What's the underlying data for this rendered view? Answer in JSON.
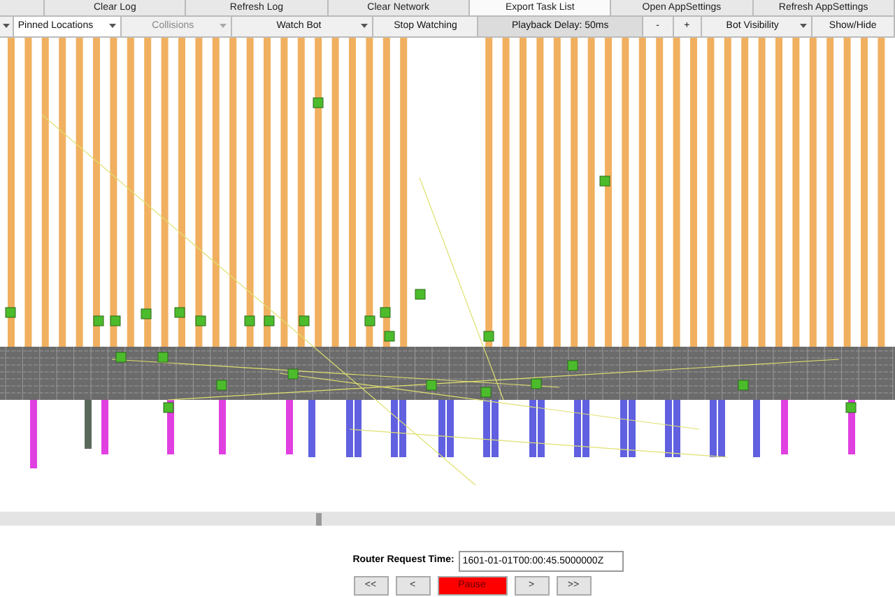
{
  "toolbar_row_1": [
    {
      "label": "Clear Log",
      "highlighted": false
    },
    {
      "label": "Refresh Log",
      "highlighted": false
    },
    {
      "label": "Clear Network",
      "highlighted": false
    },
    {
      "label": "Export Task List",
      "highlighted": true
    },
    {
      "label": "Open AppSettings",
      "highlighted": false
    },
    {
      "label": "Refresh AppSettings",
      "highlighted": false
    }
  ],
  "toolbar_row_2": [
    {
      "kind": "dropdown",
      "label": "Pinned Locations",
      "disabled": false
    },
    {
      "kind": "dropdown",
      "label": "Collisions",
      "disabled": true
    },
    {
      "kind": "dropdown",
      "label": "Watch Bot",
      "disabled": false
    },
    {
      "kind": "button",
      "label": "Stop Watching",
      "disabled": false
    },
    {
      "kind": "label",
      "label": "Playback Delay: 50ms",
      "disabled": false
    },
    {
      "kind": "button",
      "label": "-",
      "disabled": false
    },
    {
      "kind": "button",
      "label": "+",
      "disabled": false
    },
    {
      "kind": "dropdown",
      "label": "Bot Visibility",
      "disabled": false
    },
    {
      "kind": "button",
      "label": "Show/Hide",
      "disabled": false
    }
  ],
  "router_request_time": {
    "label": "Router Request Time:",
    "value": "1601-01-01T00:00:45.5000000Z"
  },
  "playback_buttons": [
    {
      "label": "<<",
      "kind": "normal"
    },
    {
      "label": "<",
      "kind": "normal"
    },
    {
      "label": "Pause",
      "kind": "active"
    },
    {
      "label": ">",
      "kind": "normal"
    },
    {
      "label": ">>",
      "kind": "normal"
    }
  ]
}
